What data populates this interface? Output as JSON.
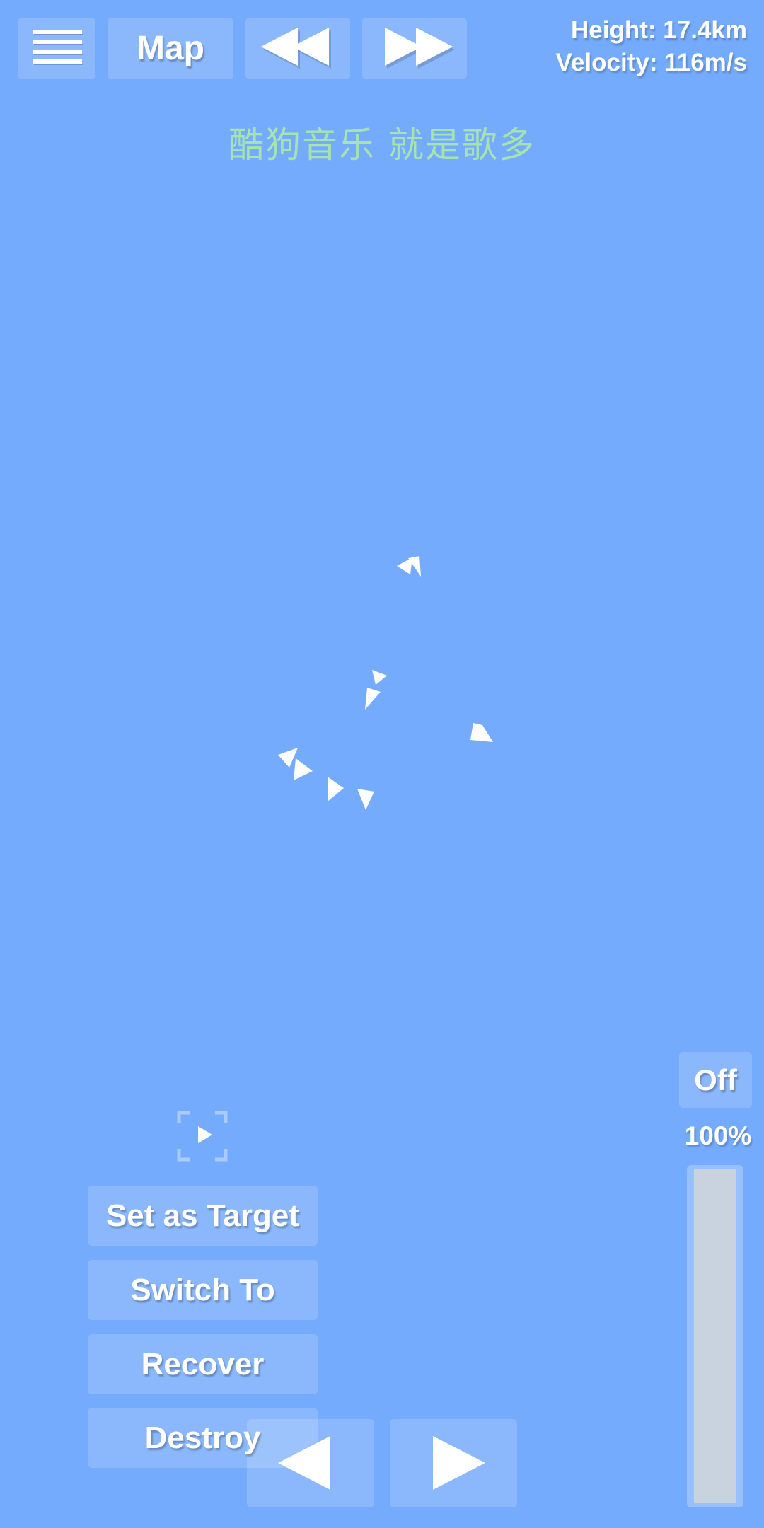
{
  "toolbar": {
    "menu_icon": "hamburger-menu-icon",
    "map_label": "Map",
    "rewind_icon": "rewind-icon",
    "fast_forward_icon": "fast-forward-icon"
  },
  "flight_info": {
    "height": "Height: 17.4km",
    "velocity": "Velocity: 116m/s"
  },
  "banner": {
    "text": "酷狗音乐  就是歌多",
    "color": "#a6e3b0"
  },
  "scene": {
    "background_color": "#75abfc",
    "debris_icon": "white-triangle-debris-icon"
  },
  "selection_panel": {
    "focus_icon": "focus-target-icon",
    "set_as_target": "Set as Target",
    "switch_to": "Switch To",
    "recover": "Recover",
    "destroy": "Destroy"
  },
  "navigation": {
    "prev_icon": "triangle-left-icon",
    "next_icon": "triangle-right-icon"
  },
  "throttle": {
    "toggle_label": "Off",
    "percent_label": "100%",
    "level": 1.0
  }
}
